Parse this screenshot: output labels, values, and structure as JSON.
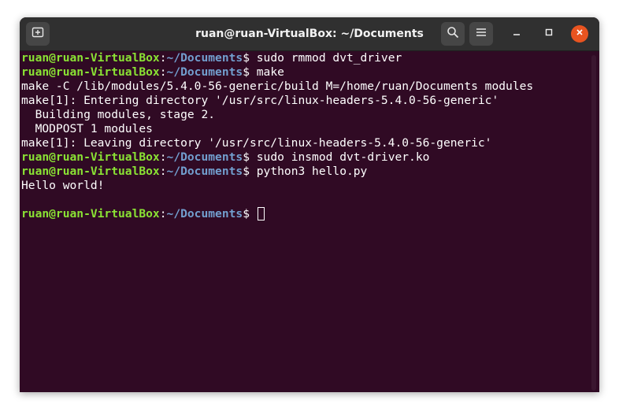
{
  "window": {
    "title": "ruan@ruan-VirtualBox: ~/Documents"
  },
  "icons": {
    "new_tab": "new-tab-icon",
    "search": "search-icon",
    "menu": "hamburger-menu-icon",
    "minimize": "minimize-icon",
    "maximize": "maximize-icon",
    "close": "close-icon"
  },
  "colors": {
    "terminal_bg": "#300a24",
    "prompt_user": "#8ae234",
    "prompt_path": "#729fcf",
    "close_button": "#e95420",
    "titlebar": "#303030"
  },
  "prompt": {
    "user_host": "ruan@ruan-VirtualBox",
    "colon": ":",
    "path": "~/Documents",
    "dollar": "$ "
  },
  "terminal": {
    "lines": [
      {
        "type": "prompt",
        "command": "sudo rmmod dvt_driver"
      },
      {
        "type": "prompt",
        "command": "make"
      },
      {
        "type": "output",
        "text": "make -C /lib/modules/5.4.0-56-generic/build M=/home/ruan/Documents modules"
      },
      {
        "type": "output",
        "text": "make[1]: Entering directory '/usr/src/linux-headers-5.4.0-56-generic'"
      },
      {
        "type": "output",
        "text": "  Building modules, stage 2."
      },
      {
        "type": "output",
        "text": "  MODPOST 1 modules"
      },
      {
        "type": "output",
        "text": "make[1]: Leaving directory '/usr/src/linux-headers-5.4.0-56-generic'"
      },
      {
        "type": "prompt",
        "command": "sudo insmod dvt-driver.ko"
      },
      {
        "type": "prompt",
        "command": "python3 hello.py"
      },
      {
        "type": "output",
        "text": "Hello world!"
      },
      {
        "type": "output",
        "text": ""
      },
      {
        "type": "prompt",
        "command": "",
        "cursor": true
      }
    ]
  }
}
